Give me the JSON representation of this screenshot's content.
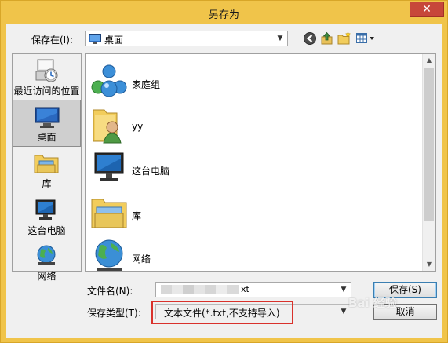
{
  "window": {
    "title": "另存为",
    "close_label": "✕"
  },
  "toolbar": {
    "save_in_label": "保存在(I):",
    "save_in_value": "桌面",
    "back_icon": "back-arrow-icon",
    "up_icon": "up-folder-icon",
    "new_folder_icon": "new-folder-icon",
    "view_menu_icon": "view-menu-icon"
  },
  "places": [
    {
      "label": "最近访问的位置",
      "icon": "recent-places-icon",
      "selected": false
    },
    {
      "label": "桌面",
      "icon": "desktop-icon",
      "selected": true
    },
    {
      "label": "库",
      "icon": "library-icon",
      "selected": false
    },
    {
      "label": "这台电脑",
      "icon": "computer-icon",
      "selected": false
    },
    {
      "label": "网络",
      "icon": "network-icon",
      "selected": false
    }
  ],
  "files": [
    {
      "label": "家庭组",
      "icon": "homegroup-icon"
    },
    {
      "label": "yy",
      "icon": "user-folder-icon"
    },
    {
      "label": "这台电脑",
      "icon": "computer-icon"
    },
    {
      "label": "库",
      "icon": "library-icon"
    },
    {
      "label": "网络",
      "icon": "network-icon"
    }
  ],
  "form": {
    "file_name_label": "文件名(N):",
    "file_name_value_visible": "xt",
    "file_type_label": "保存类型(T):",
    "file_type_value": "文本文件(*.txt,不支持导入)",
    "save_button": "保存(S)",
    "cancel_button": "取消"
  },
  "watermark": "Bai 经验",
  "colors": {
    "frame": "#f0c44a",
    "close": "#c7473a",
    "highlight": "#d9312b"
  }
}
